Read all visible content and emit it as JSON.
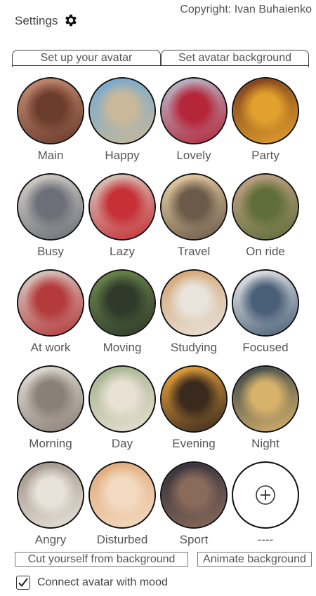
{
  "header": {
    "settings_label": "Settings",
    "settings_icon": "gear-icon",
    "copyright": "Copyright: Ivan Buhaienko"
  },
  "tabs": [
    {
      "label": "Set up your avatar",
      "active": true
    },
    {
      "label": "Set avatar background",
      "active": false
    }
  ],
  "avatars": [
    {
      "label": "Main",
      "colors": [
        "#c98f74",
        "#6b3b2c"
      ]
    },
    {
      "label": "Happy",
      "colors": [
        "#6fa9d6",
        "#c9b89a"
      ]
    },
    {
      "label": "Lovely",
      "colors": [
        "#b9c2d4",
        "#b5263a"
      ]
    },
    {
      "label": "Party",
      "colors": [
        "#7a3a1c",
        "#e2a12d"
      ]
    },
    {
      "label": "Busy",
      "colors": [
        "#d8d4cc",
        "#6c6f78"
      ]
    },
    {
      "label": "Lazy",
      "colors": [
        "#d9cfc4",
        "#c63036"
      ]
    },
    {
      "label": "Travel",
      "colors": [
        "#f0d4a8",
        "#6b5a4a"
      ]
    },
    {
      "label": "On ride",
      "colors": [
        "#c7a58a",
        "#5f6e3a"
      ]
    },
    {
      "label": "At work",
      "colors": [
        "#d9d3cb",
        "#b53a3c"
      ]
    },
    {
      "label": "Moving",
      "colors": [
        "#6e8b4e",
        "#2f3a2a"
      ]
    },
    {
      "label": "Studying",
      "colors": [
        "#d4a26e",
        "#e8e3db"
      ]
    },
    {
      "label": "Focused",
      "colors": [
        "#eeeeee",
        "#4a6078"
      ]
    },
    {
      "label": "Morning",
      "colors": [
        "#e6e2da",
        "#8a8176"
      ]
    },
    {
      "label": "Day",
      "colors": [
        "#9fb08a",
        "#e8e0d2"
      ]
    },
    {
      "label": "Evening",
      "colors": [
        "#f2a93c",
        "#3a2a1e"
      ]
    },
    {
      "label": "Night",
      "colors": [
        "#35444a",
        "#d8b26a"
      ]
    },
    {
      "label": "Angry",
      "colors": [
        "#9c8f83",
        "#e8e2da"
      ]
    },
    {
      "label": "Disturbed",
      "colors": [
        "#e0a675",
        "#f3dbc2"
      ]
    },
    {
      "label": "Sport",
      "colors": [
        "#2d2d3a",
        "#8a6a5a"
      ]
    },
    {
      "label": "----",
      "add": true,
      "icon": "plus-circle-icon"
    }
  ],
  "buttons": {
    "cut_background": "Cut yourself from background",
    "animate_background": "Animate background"
  },
  "checkbox": {
    "label": "Connect avatar with mood",
    "checked": true
  }
}
